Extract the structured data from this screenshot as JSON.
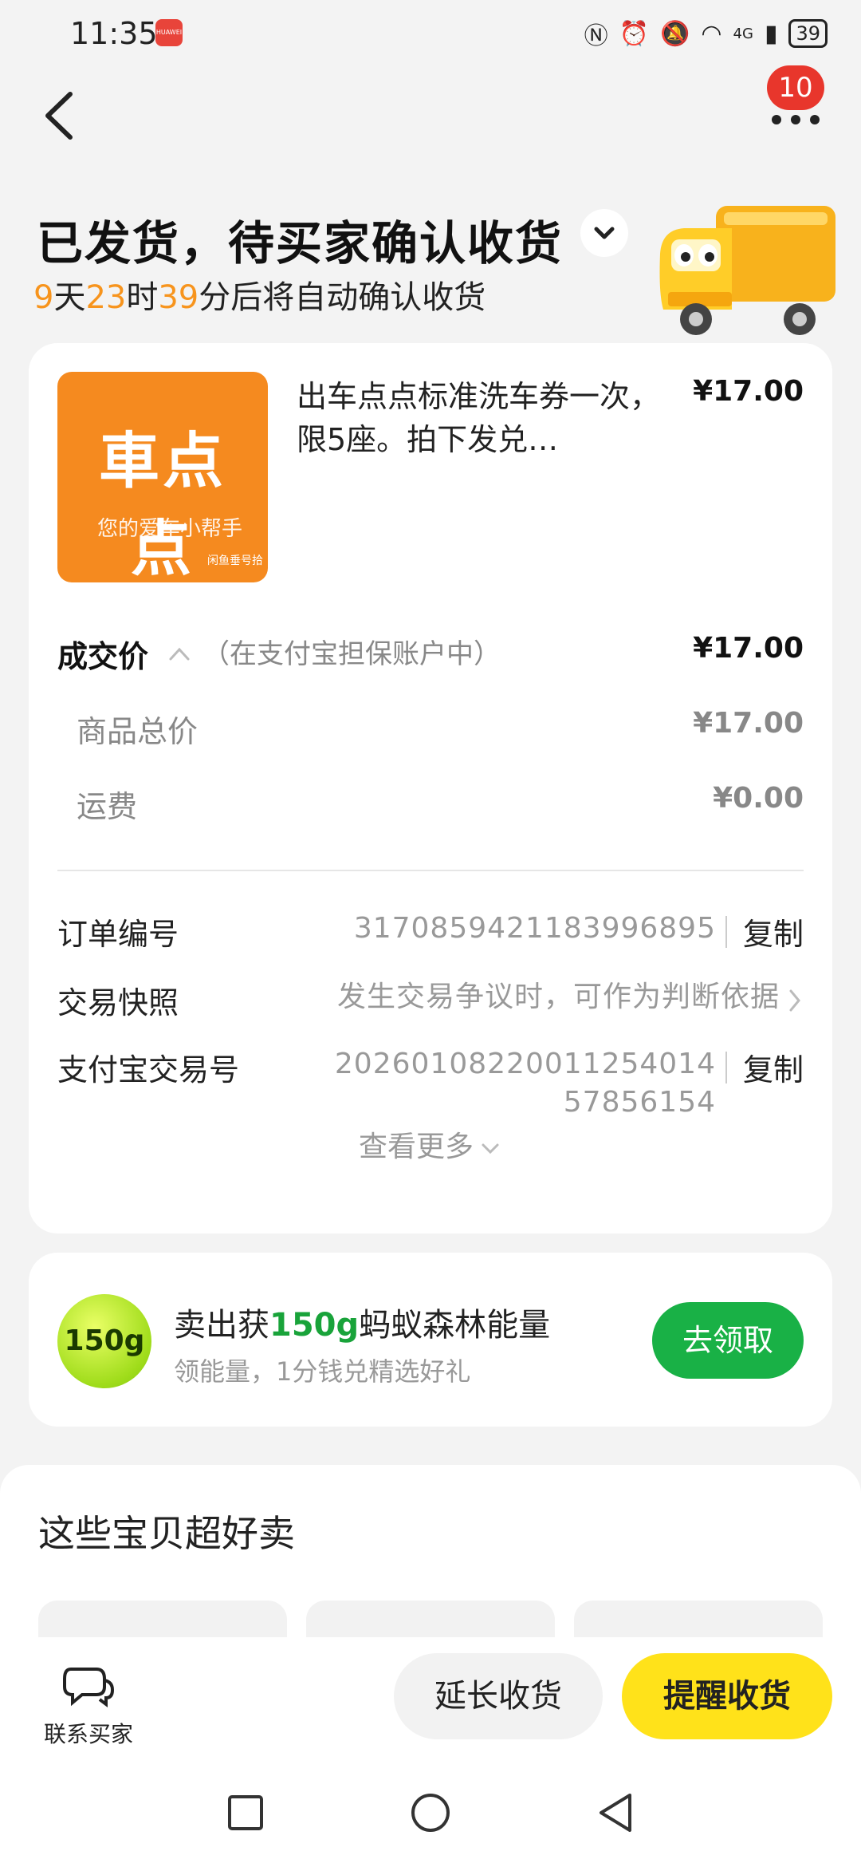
{
  "status_bar": {
    "time": "11:35",
    "notif_app": "HUAWEI",
    "network": "4G",
    "battery": "39"
  },
  "header": {
    "more_badge": "10",
    "title": "已发货，待买家确认收货",
    "countdown": {
      "d": "9",
      "d_unit": "天",
      "h": "23",
      "h_unit": "时",
      "m": "39",
      "m_unit": "分",
      "suffix": "后将自动确认收货"
    }
  },
  "product": {
    "image_logo": "車点点",
    "image_slogan": "您的爱车小帮手",
    "image_mark": "闲鱼垂号拾",
    "title": "出车点点标准洗车券一次，限5座。拍下发兑…",
    "price": "¥17.00"
  },
  "pricing": {
    "deal_label": "成交价",
    "deal_note": "（在支付宝担保账户中）",
    "deal_price": "¥17.00",
    "items": [
      {
        "label": "商品总价",
        "value": "¥17.00"
      },
      {
        "label": "运费",
        "value": "¥0.00"
      }
    ]
  },
  "order_info": {
    "order_no_label": "订单编号",
    "order_no": "3170859421183996895",
    "copy_label": "复制",
    "snapshot_label": "交易快照",
    "snapshot_value": "发生交易争议时，可作为判断依据",
    "alipay_label": "支付宝交易号",
    "alipay_no_line1": "20260108220011254014",
    "alipay_no_line2": "57856154",
    "see_more": "查看更多"
  },
  "energy": {
    "ball_text": "150g",
    "title_prefix": "卖出获",
    "title_amount": "150g",
    "title_suffix": "蚂蚁森林能量",
    "subtitle": "领能量，1分钱兑精选好礼",
    "button": "去领取"
  },
  "recommend": {
    "title": "这些宝贝超好卖"
  },
  "bottom": {
    "contact_label": "联系买家",
    "extend_button": "延长收货",
    "remind_button": "提醒收货"
  }
}
